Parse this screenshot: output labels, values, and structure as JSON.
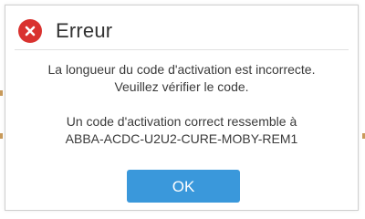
{
  "dialog": {
    "title": "Erreur",
    "icon": "error-icon",
    "accent_color": "#d9322f",
    "message_lines": [
      "La longueur du code d'activation est incorrecte.",
      "Veuillez vérifier le code.",
      "Un code d'activation correct ressemble à",
      "ABBA-ACDC-U2U2-CURE-MOBY-REM1"
    ],
    "ok_label": "OK",
    "button_color": "#3a98db"
  }
}
